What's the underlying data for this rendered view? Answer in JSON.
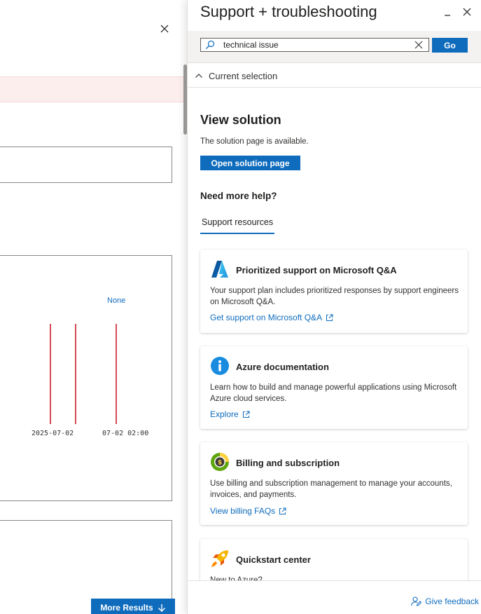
{
  "background_page": {
    "chart": {
      "annotation": "None",
      "tick_labels": [
        "2025-07-02",
        "07-02 02:00"
      ]
    },
    "more_results_label": "More Results"
  },
  "panel": {
    "title": "Support + troubleshooting",
    "search": {
      "value": "technical issue"
    },
    "go_label": "Go",
    "current_selection_label": "Current selection",
    "view_solution": {
      "heading": "View solution",
      "text": "The solution page is available.",
      "button_label": "Open solution page"
    },
    "need_help_heading": "Need more help?",
    "tab_label": "Support resources",
    "cards": [
      {
        "icon": "azure-logo-icon",
        "title": "Prioritized support on Microsoft Q&A",
        "description": "Your support plan includes prioritized responses by support engineers on Microsoft Q&A.",
        "link": "Get support on Microsoft Q&A"
      },
      {
        "icon": "info-icon",
        "title": "Azure documentation",
        "description": "Learn how to build and manage powerful applications using Microsoft Azure cloud services.",
        "link": "Explore"
      },
      {
        "icon": "billing-icon",
        "title": "Billing and subscription",
        "description": "Use billing and subscription management to manage your accounts, invoices, and payments.",
        "link": "View billing FAQs"
      },
      {
        "icon": "rocket-icon",
        "title": "Quickstart center",
        "description": "New to Azure?"
      }
    ],
    "feedback_label": "Give feedback"
  },
  "colors": {
    "accent": "#0f6cbd",
    "chart_line": "#c50f1f",
    "alert_band": "#fdeeee"
  }
}
